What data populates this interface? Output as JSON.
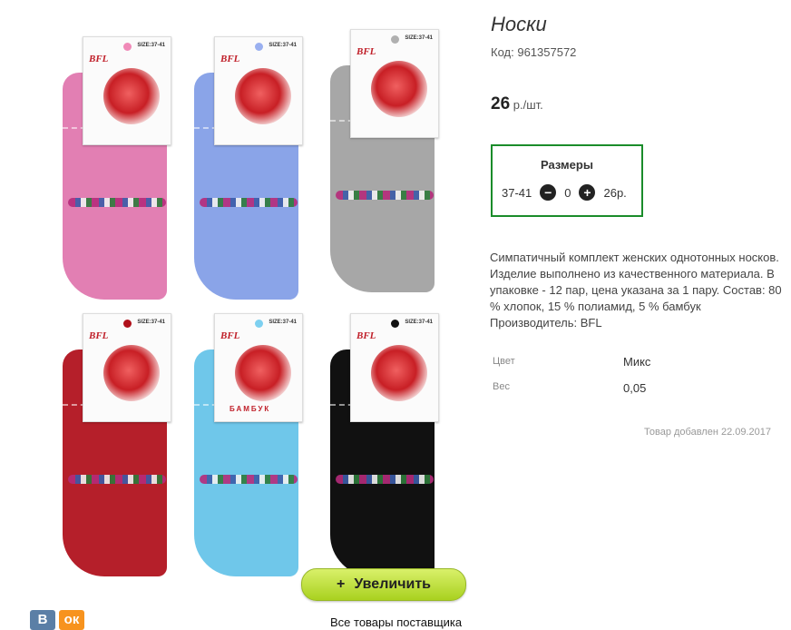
{
  "product": {
    "title": "Носки",
    "code_label": "Код:",
    "code": "961357572",
    "price": "26",
    "price_unit": "р./шт."
  },
  "sizes": {
    "title": "Размеры",
    "size": "37-41",
    "quantity": "0",
    "price": "26р."
  },
  "description": "Симпатичный комплект женских однотонных носков. Изделие выполнено из качественного материала. В упаковке - 12 пар, цена указана за 1 пару. Состав: 80 % хлопок, 15 % полиамид, 5 % бамбук Производитель: BFL",
  "attributes": [
    {
      "label": "Цвет",
      "value": "Микс"
    },
    {
      "label": "Вес",
      "value": "0,05"
    }
  ],
  "added": "Товар добавлен 22.09.2017",
  "image": {
    "zoom_label": "Увеличить",
    "tag_brand": "BFL",
    "tag_size": "SIZE:37-41",
    "tag_word": "БАМБУК",
    "socks": [
      {
        "color": "#e27fb3",
        "dot": "#f08ab8"
      },
      {
        "color": "#8aa4e8",
        "dot": "#9ab0f0"
      },
      {
        "color": "#a7a7a7",
        "dot": "#b0b0b0"
      },
      {
        "color": "#b51f2a",
        "dot": "#b0101a"
      },
      {
        "color": "#6fc7ea",
        "dot": "#7dd0f0"
      },
      {
        "color": "#111111",
        "dot": "#111111"
      }
    ]
  },
  "social": {
    "vk": "В",
    "ok": "ок"
  },
  "supplier_link": "Все товары поставщика",
  "colors": {
    "accent_border": "#1a8c2a",
    "zoom_button": "#b8dc2e"
  }
}
